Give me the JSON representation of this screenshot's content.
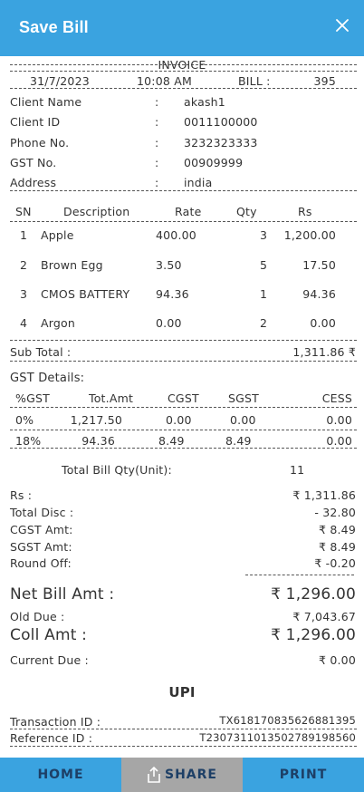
{
  "header": {
    "title": "Save Bill",
    "close_icon": "close-icon"
  },
  "invoice": {
    "heading": "INVOICE",
    "date": "31/7/2023",
    "time": "10:08 AM",
    "bill_label": "BILL :",
    "bill_no": "395"
  },
  "client": [
    {
      "label": "Client Name",
      "sep": ":",
      "value": "akash1"
    },
    {
      "label": "Client ID",
      "sep": ":",
      "value": "0011100000"
    },
    {
      "label": "Phone No.",
      "sep": ":",
      "value": "3232323333"
    },
    {
      "label": "GST No.",
      "sep": ":",
      "value": "00909999"
    },
    {
      "label": "Address",
      "sep": ":",
      "value": "india"
    }
  ],
  "items_table": {
    "headers": [
      "SN",
      "Description",
      "Rate",
      "Qty",
      "Rs"
    ],
    "rows": [
      {
        "sn": "1",
        "desc": "Apple",
        "rate": "400.00",
        "qty": "3",
        "rs": "1,200.00"
      },
      {
        "sn": "2",
        "desc": "Brown Egg",
        "rate": "3.50",
        "qty": "5",
        "rs": "17.50"
      },
      {
        "sn": "3",
        "desc": "CMOS BATTERY",
        "rate": "94.36",
        "qty": "1",
        "rs": "94.36"
      },
      {
        "sn": "4",
        "desc": "Argon",
        "rate": "0.00",
        "qty": "2",
        "rs": "0.00"
      }
    ]
  },
  "subtotal": {
    "label": "Sub Total :",
    "value": "1,311.86 ₹"
  },
  "gst": {
    "title": "GST Details:",
    "headers": [
      "%GST",
      "Tot.Amt",
      "CGST",
      "SGST",
      "CESS"
    ],
    "rows": [
      {
        "pct": "0%",
        "tot": "1,217.50",
        "cgst": "0.00",
        "sgst": "0.00",
        "cess": "0.00"
      },
      {
        "pct": "18%",
        "tot": "94.36",
        "cgst": "8.49",
        "sgst": "8.49",
        "cess": "0.00"
      }
    ]
  },
  "total_qty": {
    "label": "Total Bill Qty(Unit):",
    "value": "11"
  },
  "summary": [
    {
      "label": "Rs :",
      "value": "₹ 1,311.86"
    },
    {
      "label": "Total Disc :",
      "value": "- 32.80"
    },
    {
      "label": "CGST Amt:",
      "value": "₹ 8.49"
    },
    {
      "label": "SGST Amt:",
      "value": "₹ 8.49"
    },
    {
      "label": "Round Off:",
      "value": "₹ -0.20"
    }
  ],
  "net_bill": {
    "label": "Net Bill Amt :",
    "value": "₹ 1,296.00"
  },
  "old_due": {
    "label": "Old Due :",
    "value": "₹ 7,043.67"
  },
  "coll_amt": {
    "label": "Coll Amt :",
    "value": "₹ 1,296.00"
  },
  "current_due": {
    "label": "Current Due :",
    "value": "₹ 0.00"
  },
  "upi": {
    "title": "UPI",
    "transaction_label": "Transaction ID :",
    "transaction_id": "TX618170835626881395",
    "reference_label": "Reference ID :",
    "reference_id": "T2307311013502789198560"
  },
  "footer": {
    "home": "HOME",
    "share": "SHARE",
    "print": "PRINT",
    "share_icon": "share-icon"
  },
  "colors": {
    "header_bg": "#3aa3e0",
    "footer_blue": "#3aa3e0",
    "footer_grey": "#a6a6a6",
    "footer_text": "#1d3f66"
  }
}
